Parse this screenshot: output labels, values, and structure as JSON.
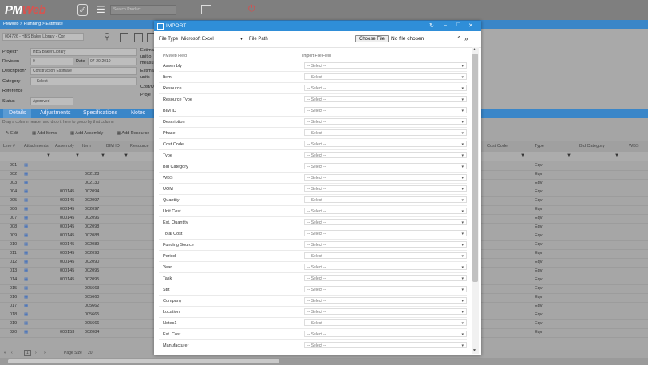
{
  "header": {
    "logo_text": "PM",
    "logo_accent": "Web",
    "search_placeholder": "Search Product"
  },
  "breadcrumb": "PMWeb > Planning > Estimate",
  "form": {
    "record": "004726 - HBS Baker Library - Cor",
    "project_label": "Project*",
    "project_value": "HBS Baker Library",
    "revision_label": "Revision",
    "revision_value": "0",
    "date_label": "Date",
    "date_value": "07-20-2010",
    "description_label": "Description*",
    "description_value": "Construction Estimate",
    "category_label": "Category",
    "category_value": "-- Select --",
    "reference_label": "Reference",
    "status_label": "Status",
    "status_value": "Approved",
    "right_labels": [
      "Estimat",
      "unit o",
      "measu",
      "Estimat",
      "units",
      "Cost/U",
      "Proje"
    ]
  },
  "tabs": [
    "Details",
    "Adjustments",
    "Specifications",
    "Notes"
  ],
  "group_hint": "Drag a column header and drop it here to group by that column",
  "grid_tools": [
    "Edit",
    "Add Items",
    "Add Assembly",
    "Add Resource"
  ],
  "grid_headers": [
    "Line #",
    "Attachments",
    "Assembly",
    "Item",
    "BIM ID",
    "Resource",
    "Cost Code",
    "Type",
    "Bid Category",
    "WBS"
  ],
  "rows": [
    {
      "line": "001",
      "assembly": "",
      "item": "",
      "type": "Eqv"
    },
    {
      "line": "002",
      "assembly": "",
      "item": "002128",
      "type": "Eqv"
    },
    {
      "line": "003",
      "assembly": "",
      "item": "002130",
      "type": "Eqv"
    },
    {
      "line": "004",
      "assembly": "000145",
      "item": "002094",
      "type": "Eqv"
    },
    {
      "line": "005",
      "assembly": "000145",
      "item": "002097",
      "type": "Eqv"
    },
    {
      "line": "006",
      "assembly": "000145",
      "item": "002097",
      "type": "Eqv"
    },
    {
      "line": "007",
      "assembly": "000145",
      "item": "002096",
      "type": "Eqv"
    },
    {
      "line": "008",
      "assembly": "000145",
      "item": "002098",
      "type": "Eqv"
    },
    {
      "line": "009",
      "assembly": "000145",
      "item": "002088",
      "type": "Eqv"
    },
    {
      "line": "010",
      "assembly": "000145",
      "item": "002089",
      "type": "Eqv"
    },
    {
      "line": "011",
      "assembly": "000145",
      "item": "002093",
      "type": "Eqv"
    },
    {
      "line": "012",
      "assembly": "000145",
      "item": "002090",
      "type": "Eqv"
    },
    {
      "line": "013",
      "assembly": "000145",
      "item": "002095",
      "type": "Eqv"
    },
    {
      "line": "014",
      "assembly": "000145",
      "item": "002095",
      "type": "Eqv"
    },
    {
      "line": "015",
      "assembly": "",
      "item": "005663",
      "type": "Eqv"
    },
    {
      "line": "016",
      "assembly": "",
      "item": "005660",
      "type": "Eqv"
    },
    {
      "line": "017",
      "assembly": "",
      "item": "005662",
      "type": "Eqv"
    },
    {
      "line": "018",
      "assembly": "",
      "item": "005665",
      "type": "Eqv"
    },
    {
      "line": "019",
      "assembly": "",
      "item": "005666",
      "type": "Eqv"
    },
    {
      "line": "020",
      "assembly": "000153",
      "item": "002084",
      "type": "Eqv"
    }
  ],
  "pager": {
    "page": "1",
    "page_size_label": "Page Size",
    "page_size": "20"
  },
  "modal": {
    "title": "IMPORT",
    "file_type_label": "File Type",
    "file_type_value": "Microsoft Excel",
    "file_path_label": "File Path",
    "choose_file": "Choose File",
    "no_file": "No file chosen",
    "col_pmweb": "PMWeb Field",
    "col_import": "Import File Field",
    "select_placeholder": "-- Select --",
    "fields": [
      "Assembly",
      "Item",
      "Resource",
      "Resource Type",
      "BIM ID",
      "Description",
      "Phase",
      "Cost Code",
      "Type",
      "Bid Category",
      "WBS",
      "UOM",
      "Quantity",
      "Unit Cost",
      "Ext. Quantity",
      "Total Cost",
      "Funding Source",
      "Period",
      "Year",
      "Task",
      "Strt",
      "Company",
      "Location",
      "Notes1",
      "Ext. Cost",
      "Manufacturer"
    ]
  },
  "colors": {
    "accent": "#2f8ed8",
    "breadcrumb": "#3a86c8",
    "power": "#e04848"
  }
}
